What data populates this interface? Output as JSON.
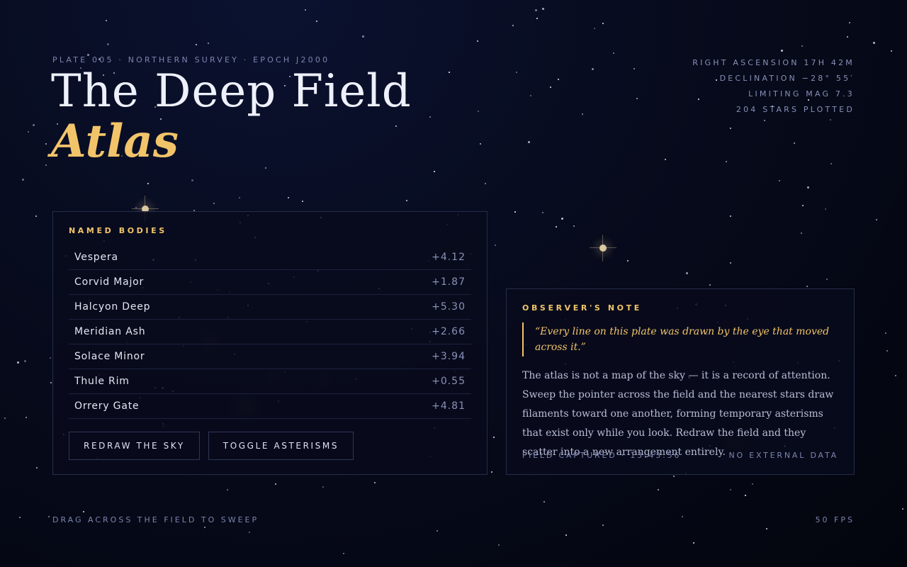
{
  "header": {
    "plate_line": "PLATE 005 · NORTHERN SURVEY · EPOCH J2000",
    "title": "The Deep Field",
    "subtitle": "Atlas"
  },
  "coordinates": [
    "RIGHT ASCENSION 17H 42M",
    "DECLINATION −28° 55′",
    "LIMITING MAG 7.3",
    "204 STARS PLOTTED"
  ],
  "named_bodies": {
    "heading": "NAMED BODIES",
    "items": [
      {
        "name": "Vespera",
        "magnitude": "+4.12"
      },
      {
        "name": "Corvid Major",
        "magnitude": "+1.87"
      },
      {
        "name": "Halcyon Deep",
        "magnitude": "+5.30"
      },
      {
        "name": "Meridian Ash",
        "magnitude": "+2.66"
      },
      {
        "name": "Solace Minor",
        "magnitude": "+3.94"
      },
      {
        "name": "Thule Rim",
        "magnitude": "+0.55"
      },
      {
        "name": "Orrery Gate",
        "magnitude": "+4.81"
      }
    ],
    "buttons": {
      "redraw": "REDRAW THE SKY",
      "toggle": "TOGGLE ASTERISMS"
    }
  },
  "observers_note": {
    "heading": "OBSERVER'S NOTE",
    "quote": "“Every line on this plate was drawn by the eye that moved across it.”",
    "body": "The atlas is not a map of the sky — it is a record of attention. Sweep the pointer across the field and the nearest stars draw filaments toward one another, forming temporary asterisms that exist only while you look. Redraw the field and they scatter into a new arrangement entirely.",
    "footer_left": "FIELD CAPTURED · 13:43:56",
    "footer_right": "NO EXTERNAL DATA"
  },
  "footer": {
    "hint": "DRAG ACROSS THE FIELD TO SWEEP",
    "fps": "50 FPS"
  },
  "colors": {
    "accent": "#f2c46a",
    "background": "#070b1d",
    "muted_text": "#7c84b0"
  }
}
